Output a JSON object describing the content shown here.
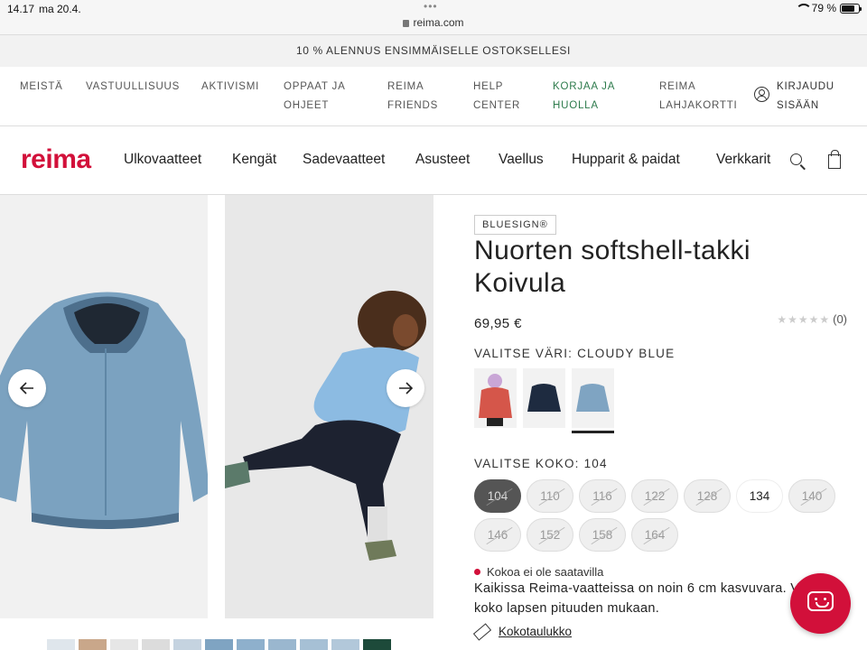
{
  "status_bar": {
    "time": "14.17",
    "date": "ma 20.4.",
    "url": "reima.com",
    "battery": "79 %",
    "battery_level": 0.79
  },
  "promo": {
    "text": "10 % ALENNUS ENSIMMÄISELLE OSTOKSELLESI"
  },
  "top_nav": {
    "items": [
      {
        "line1": "MEISTÄ",
        "line2": ""
      },
      {
        "line1": "VASTUULLISUUS",
        "line2": ""
      },
      {
        "line1": "AKTIVISMI",
        "line2": ""
      },
      {
        "line1": "OPPAAT JA",
        "line2": "OHJEET"
      },
      {
        "line1": "REIMA",
        "line2": "FRIENDS"
      },
      {
        "line1": "HELP",
        "line2": "CENTER"
      },
      {
        "line1": "KORJAA JA",
        "line2": "HUOLLA"
      },
      {
        "line1": "REIMA",
        "line2": "LAHJAKORTTI"
      }
    ],
    "login": {
      "line1": "KIRJAUDU",
      "line2": "SISÄÄN"
    },
    "highlight_color": "#2c7a4b"
  },
  "main_nav": {
    "logo": "reima",
    "brand_color": "#d2103a",
    "categories": [
      "Ulkovaatteet",
      "Kengät",
      "Sadevaatteet",
      "Asusteet",
      "Vaellus",
      "Hupparit & paidat",
      "Verkkarit"
    ],
    "icons": [
      "search-icon",
      "bag-icon"
    ]
  },
  "gallery": {
    "icons": [
      "arrow-left-icon",
      "arrow-right-icon"
    ],
    "thumbnail_count": 11
  },
  "product": {
    "badge": "BLUESIGN®",
    "title_line1": "Nuorten softshell-takki",
    "title_line2": "Koivula",
    "price": "69,95 €",
    "rating": {
      "stars": "★★★★★",
      "count": "(0)",
      "value": 0
    },
    "color_label": "VALITSE VÄRI: CLOUDY BLUE",
    "colors": [
      {
        "name": "red",
        "hex": "#d5564a",
        "selected": false
      },
      {
        "name": "navy",
        "hex": "#1e2b40",
        "selected": false
      },
      {
        "name": "cloudy blue",
        "hex": "#7fa4c2",
        "selected": true
      }
    ],
    "size_label": "VALITSE KOKO: 104",
    "sizes": [
      {
        "label": "104",
        "state": "selected"
      },
      {
        "label": "110",
        "state": "unavailable"
      },
      {
        "label": "116",
        "state": "unavailable"
      },
      {
        "label": "122",
        "state": "unavailable"
      },
      {
        "label": "128",
        "state": "unavailable"
      },
      {
        "label": "134",
        "state": "available"
      },
      {
        "label": "140",
        "state": "unavailable"
      },
      {
        "label": "146",
        "state": "unavailable"
      },
      {
        "label": "152",
        "state": "unavailable"
      },
      {
        "label": "158",
        "state": "unavailable"
      },
      {
        "label": "164",
        "state": "unavailable"
      }
    ],
    "availability": "Kokoa ei ole saatavilla",
    "growth_note": "Kaikissa Reima-vaatteissa on noin 6 cm kasvuvara. Valitse koko lapsen pituuden mukaan.",
    "size_chart_link": "Kokotaulukko"
  },
  "chat": {
    "icon": "chat-icon"
  }
}
